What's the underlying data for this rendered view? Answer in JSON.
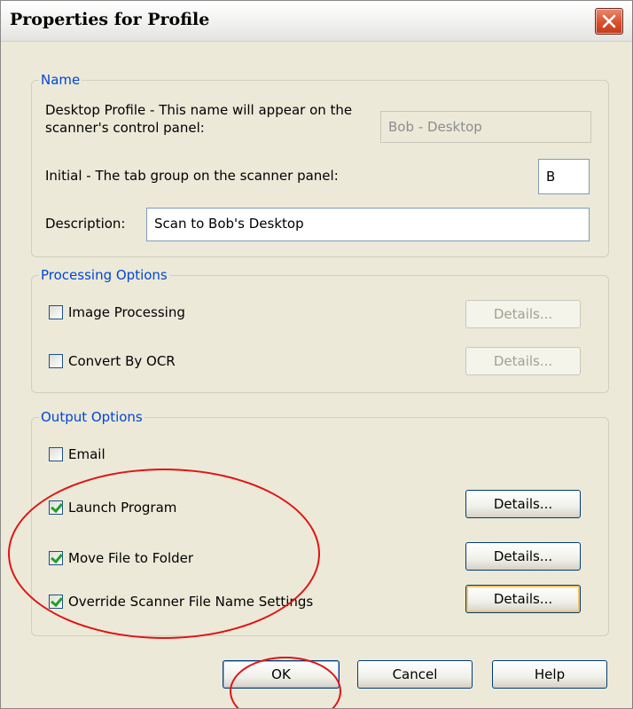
{
  "window": {
    "title": "Properties for Profile",
    "close_icon": "close-icon"
  },
  "name_group": {
    "legend": "Name",
    "profile_label": "Desktop Profile - This name will appear on the scanner's control panel:",
    "profile_value": "Bob - Desktop",
    "initial_label": "Initial - The tab group on the scanner panel:",
    "initial_value": "B",
    "description_label": "Description:",
    "description_value": "Scan to Bob's Desktop"
  },
  "processing_group": {
    "legend": "Processing Options",
    "items": [
      {
        "label": "Image Processing",
        "checked": false,
        "details_label": "Details...",
        "details_enabled": false
      },
      {
        "label": "Convert By OCR",
        "checked": false,
        "details_label": "Details...",
        "details_enabled": false
      }
    ]
  },
  "output_group": {
    "legend": "Output Options",
    "items": [
      {
        "label": "Email",
        "checked": false
      },
      {
        "label": "Launch Program",
        "checked": true,
        "details_label": "Details..."
      },
      {
        "label": "Move File to Folder",
        "checked": true,
        "details_label": "Details..."
      },
      {
        "label": "Override Scanner File Name Settings",
        "checked": true,
        "details_label": "Details..."
      }
    ]
  },
  "footer": {
    "ok_label": "OK",
    "cancel_label": "Cancel",
    "help_label": "Help"
  },
  "colors": {
    "legend": "#0046d5",
    "annotation": "#e01414",
    "checkmark": "#21a121"
  }
}
